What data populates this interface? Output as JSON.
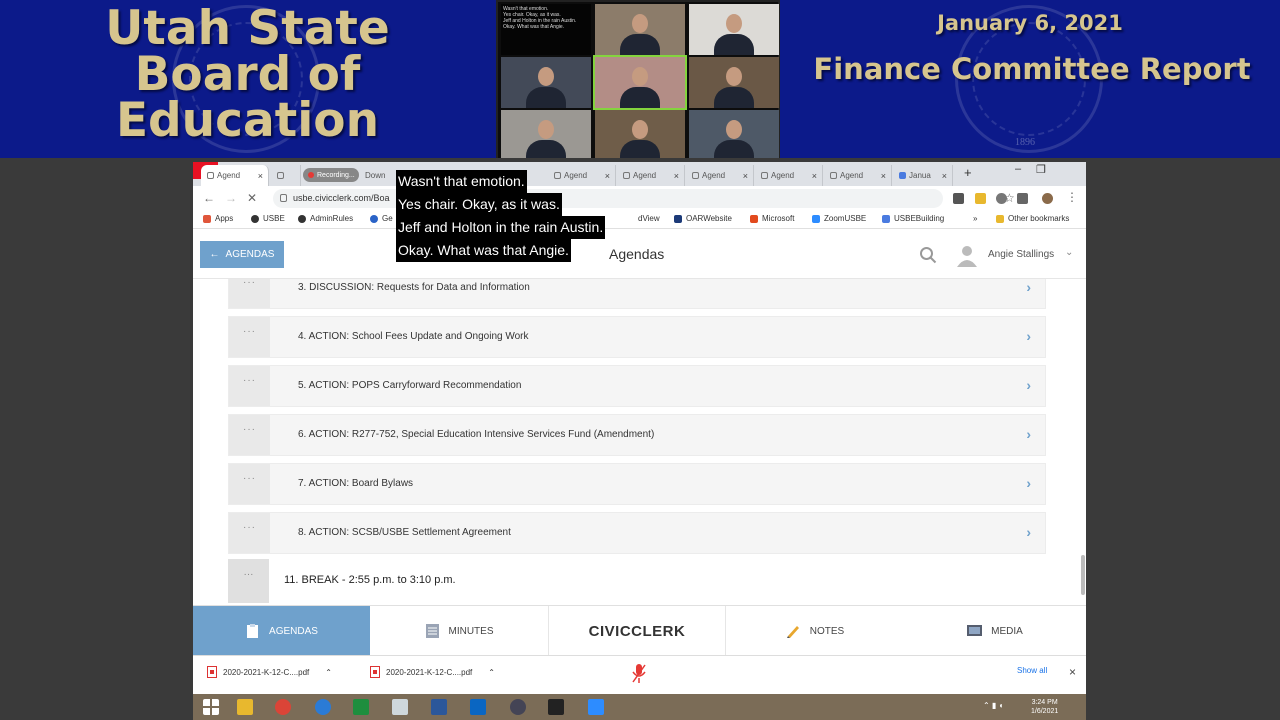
{
  "banner": {
    "org_title": "Utah State Board of Education",
    "meeting_date": "January 6, 2021",
    "report_title": "Finance Committee Report",
    "seal_year": "1896",
    "colors": {
      "background": "#0c1a8a",
      "title_gold": "#d6c58e"
    }
  },
  "zoom_gallery": {
    "caption_preview": [
      "Wasn't that emotion.",
      "Yes chair. Okay, as it was.",
      "Jeff and Holton in the rain Austin.",
      "Okay. What was that Angie."
    ]
  },
  "browser": {
    "tabs": [
      "Agend",
      "Recording...",
      "Down",
      "Agend",
      "Agend",
      "Agend",
      "Agend",
      "Agend",
      "Janua"
    ],
    "url": "usbe.civicclerk.com/Boa",
    "bookmarks": [
      "Apps",
      "USBE",
      "AdminRules",
      "Ge",
      "dView",
      "OARWebsite",
      "Microsoft",
      "ZoomUSBE",
      "USBEBuilding",
      "»",
      "Other bookmarks"
    ]
  },
  "page": {
    "back_button": "AGENDAS",
    "title": "Agendas",
    "user_name": "Angie Stallings",
    "agenda_items": [
      "3. DISCUSSION: Requests for Data and Information",
      "4. ACTION: School Fees Update and Ongoing Work",
      "5. ACTION: POPS Carryforward Recommendation",
      "6. ACTION: R277-752, Special Education Intensive Services Fund (Amendment)",
      "7. ACTION: Board Bylaws",
      "8. ACTION: SCSB/USBE Settlement Agreement"
    ],
    "break_item": "11. BREAK - 2:55 p.m. to 3:10 p.m.",
    "handle_glyph": "···",
    "accent_color": "#6fa1cc"
  },
  "bottom_nav": {
    "agendas": "AGENDAS",
    "minutes": "MINUTES",
    "brand": "CIVICCLERK",
    "notes": "NOTES",
    "media": "MEDIA"
  },
  "downloads": {
    "files": [
      "2020-2021-K-12-C....pdf",
      "2020-2021-K-12-C....pdf"
    ],
    "show_all": "Show all"
  },
  "captions": [
    "Wasn't that emotion.",
    "Yes chair. Okay, as it was.",
    "Jeff and Holton in the rain Austin.",
    "Okay. What was that Angie."
  ],
  "taskbar": {
    "time": "3:24 PM",
    "date": "1/6/2021"
  }
}
